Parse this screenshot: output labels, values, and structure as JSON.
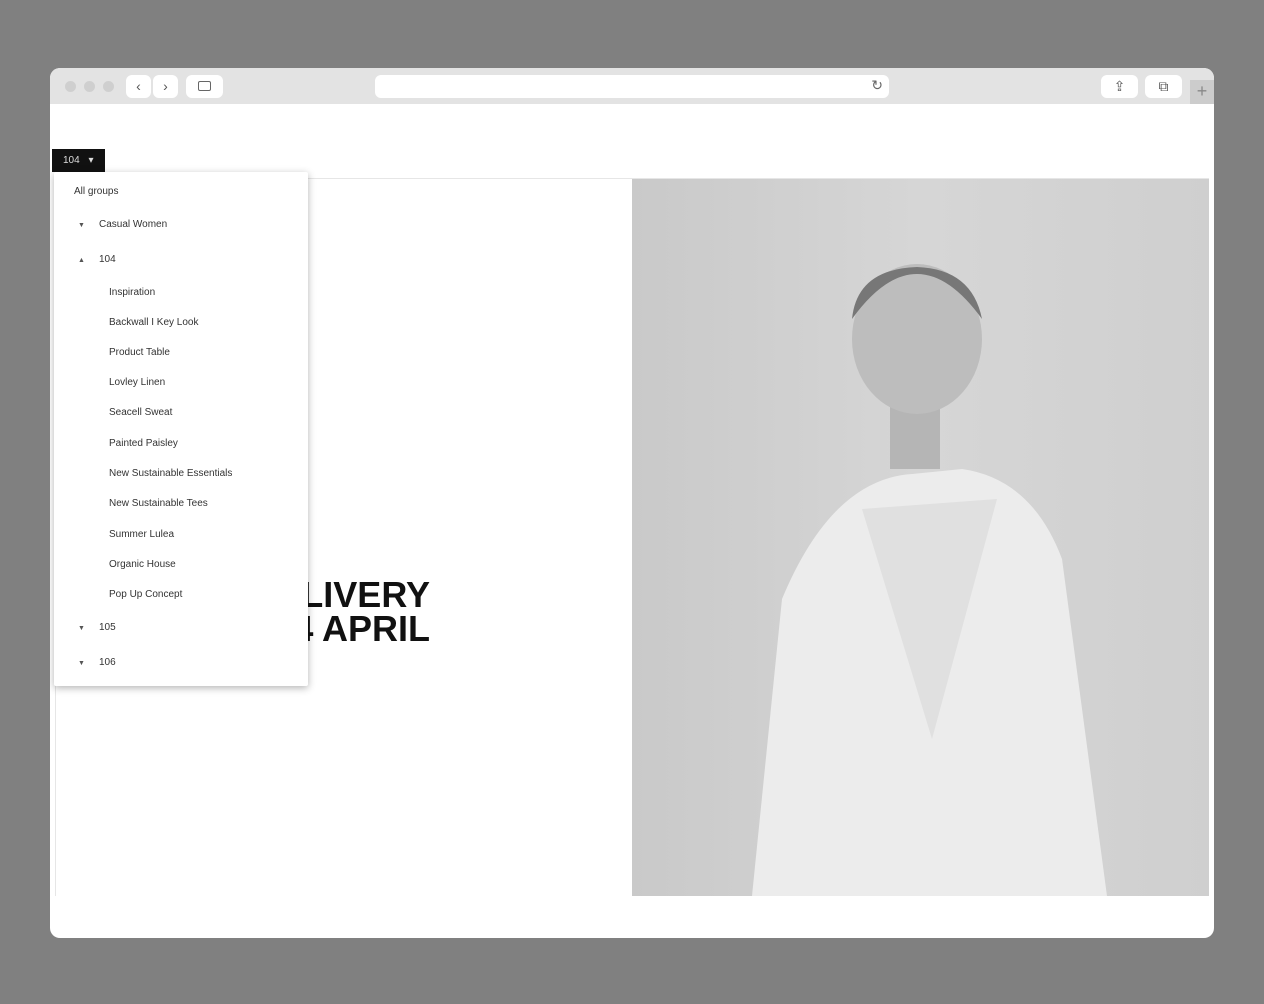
{
  "browser": {
    "back_icon": "‹",
    "forward_icon": "›",
    "reload_icon": "↻",
    "new_tab_icon": "+"
  },
  "selector": {
    "value": "104",
    "chevron": "⌄"
  },
  "menu": {
    "all_groups": "All groups",
    "groups": [
      {
        "label": "Casual Women",
        "expanded": false
      },
      {
        "label": "104",
        "expanded": true,
        "children": [
          "Inspiration",
          "Backwall I Key Look",
          "Product Table",
          "Lovley Linen",
          "Seacell Sweat",
          "Painted Paisley",
          "New Sustainable Essentials",
          "New Sustainable Tees",
          "Summer Lulea",
          "Organic House",
          "Pop Up Concept"
        ]
      },
      {
        "label": "105",
        "expanded": false
      },
      {
        "label": "106",
        "expanded": false
      }
    ]
  },
  "hero": {
    "line1": "LIVERY",
    "line2": "4 APRIL"
  }
}
